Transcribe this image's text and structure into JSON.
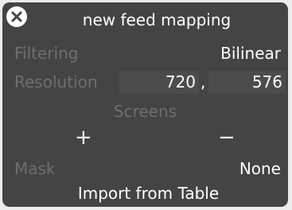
{
  "dialog": {
    "title": "new feed mapping",
    "close_icon": "close-circle-icon"
  },
  "filtering": {
    "label": "Filtering",
    "value": "Bilinear"
  },
  "resolution": {
    "label": "Resolution",
    "width": "720",
    "separator": ",",
    "height": "576"
  },
  "screens": {
    "label": "Screens",
    "add_symbol": "+",
    "remove_symbol": "−"
  },
  "mask": {
    "label": "Mask",
    "value": "None"
  },
  "import": {
    "label": "Import from Table"
  },
  "colors": {
    "panel_bg": "#444444",
    "field_bg": "#4c4c4c",
    "dim_text": "#6f6f6f",
    "text": "#ffffff"
  }
}
